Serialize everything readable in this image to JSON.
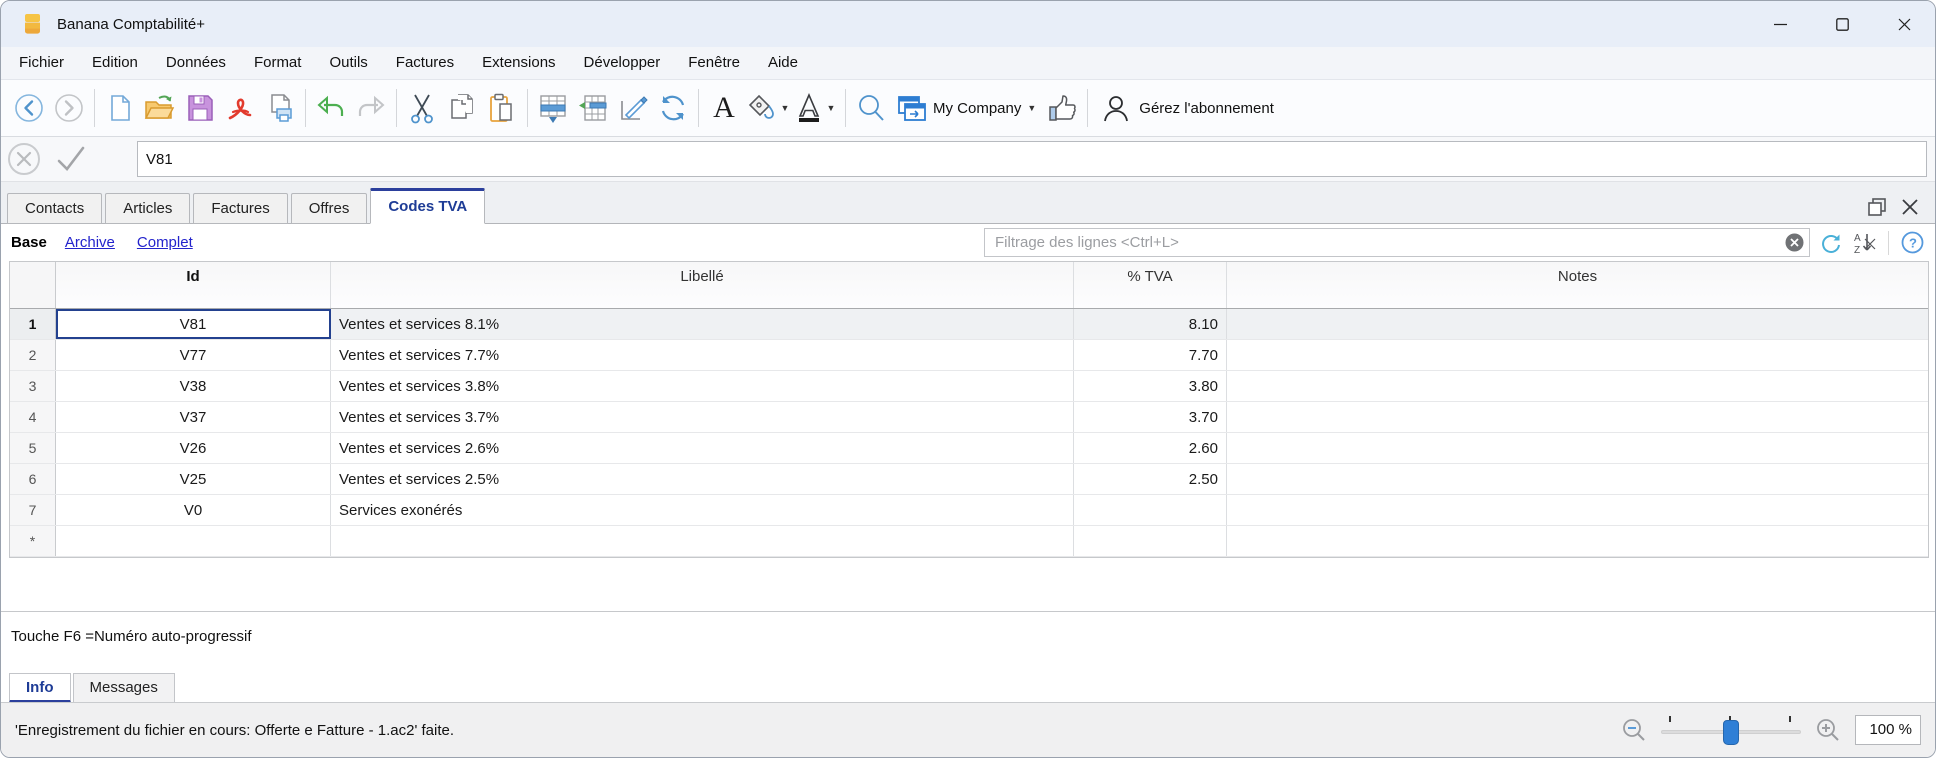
{
  "window": {
    "title": "Banana Comptabilité+"
  },
  "menu": {
    "items": [
      "Fichier",
      "Edition",
      "Données",
      "Format",
      "Outils",
      "Factures",
      "Extensions",
      "Développer",
      "Fenêtre",
      "Aide"
    ]
  },
  "toolbar": {
    "company_name": "My Company",
    "subscription_label": "Gérez l'abonnement",
    "icons": [
      "back",
      "forward",
      "new-file",
      "open-file",
      "save",
      "pdf-export",
      "print",
      "undo",
      "redo",
      "cut",
      "copy",
      "paste",
      "insert-row",
      "extract-rows",
      "edit-cell",
      "recalculate",
      "bold",
      "background-color",
      "text-color",
      "search",
      "company-window",
      "like",
      "account"
    ]
  },
  "formula": {
    "value": "V81"
  },
  "tabs": {
    "items": [
      "Contacts",
      "Articles",
      "Factures",
      "Offres",
      "Codes TVA"
    ],
    "active": "Codes TVA"
  },
  "views": {
    "base": "Base",
    "archive": "Archive",
    "complet": "Complet"
  },
  "filter": {
    "placeholder": "Filtrage des lignes <Ctrl+L>"
  },
  "table": {
    "columns": [
      "Id",
      "Libellé",
      "% TVA",
      "Notes"
    ],
    "rows": [
      {
        "num": "1",
        "id": "V81",
        "label": "Ventes et services 8.1%",
        "tva": "8.10",
        "notes": ""
      },
      {
        "num": "2",
        "id": "V77",
        "label": "Ventes et services 7.7%",
        "tva": "7.70",
        "notes": ""
      },
      {
        "num": "3",
        "id": "V38",
        "label": "Ventes et services 3.8%",
        "tva": "3.80",
        "notes": ""
      },
      {
        "num": "4",
        "id": "V37",
        "label": "Ventes et services 3.7%",
        "tva": "3.70",
        "notes": ""
      },
      {
        "num": "5",
        "id": "V26",
        "label": "Ventes et services 2.6%",
        "tva": "2.60",
        "notes": ""
      },
      {
        "num": "6",
        "id": "V25",
        "label": "Ventes et services 2.5%",
        "tva": "2.50",
        "notes": ""
      },
      {
        "num": "7",
        "id": "V0",
        "label": "Services exonérés",
        "tva": "",
        "notes": ""
      },
      {
        "num": "*",
        "id": "",
        "label": "",
        "tva": "",
        "notes": ""
      }
    ],
    "selected_row": "1"
  },
  "hint": "Touche F6 =Numéro auto-progressif",
  "bottom_tabs": {
    "items": [
      "Info",
      "Messages"
    ],
    "active": "Info"
  },
  "status": {
    "message": "'Enregistrement du fichier en cours: Offerte e Fatture - 1.ac2' faite.",
    "zoom": "100 %"
  },
  "colors": {
    "accent": "#2b3f9c",
    "link": "#2323cc",
    "selection": "#23418f",
    "slider_handle": "#2f7fd6",
    "logo": "#f2b940"
  }
}
